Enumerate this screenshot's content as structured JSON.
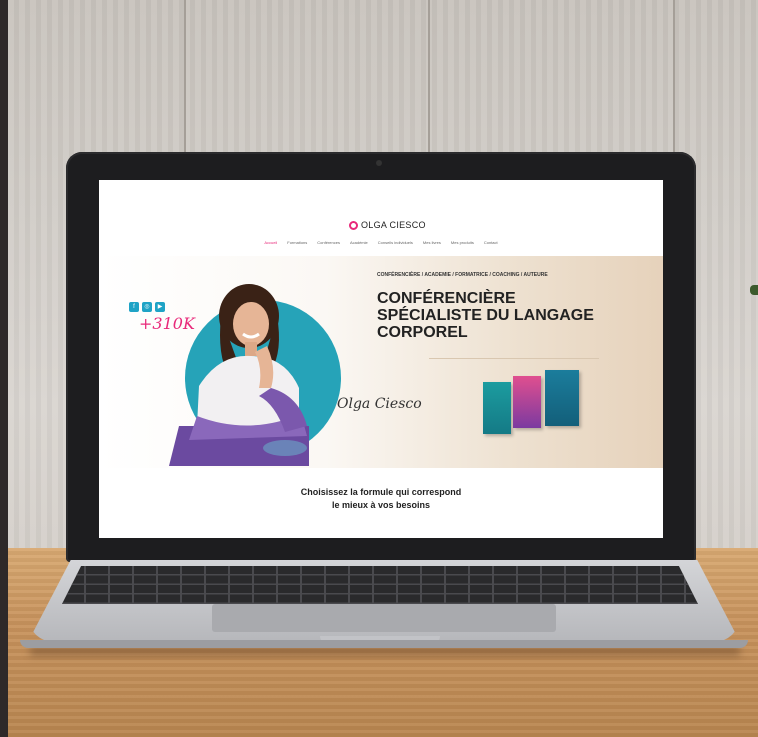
{
  "site": {
    "logo_text": "OLGA CIESCO",
    "nav_items": [
      "Accueil",
      "Formations",
      "Conférences",
      "Académie",
      "Conseils individuels",
      "Mes livres",
      "Mes produits",
      "Contact"
    ],
    "hero": {
      "eyebrow": "CONFÉRENCIÈRE / ACADEMIE / FORMATRICE / COACHING / AUTEURE",
      "headline_line1": "CONFÉRENCIÈRE",
      "headline_line2": "SPÉCIALISTE DU LANGAGE",
      "headline_line3": "CORPOREL",
      "followers": "+310K",
      "signature": "Olga Ciesco"
    },
    "cta_line1": "Choisissez la formule qui correspond",
    "cta_line2": "le mieux à vos besoins"
  },
  "colors": {
    "accent": "#e8297a",
    "teal": "#26a3b8",
    "wood": "#c8935d"
  },
  "icons": [
    "facebook-icon",
    "instagram-icon",
    "youtube-icon"
  ]
}
